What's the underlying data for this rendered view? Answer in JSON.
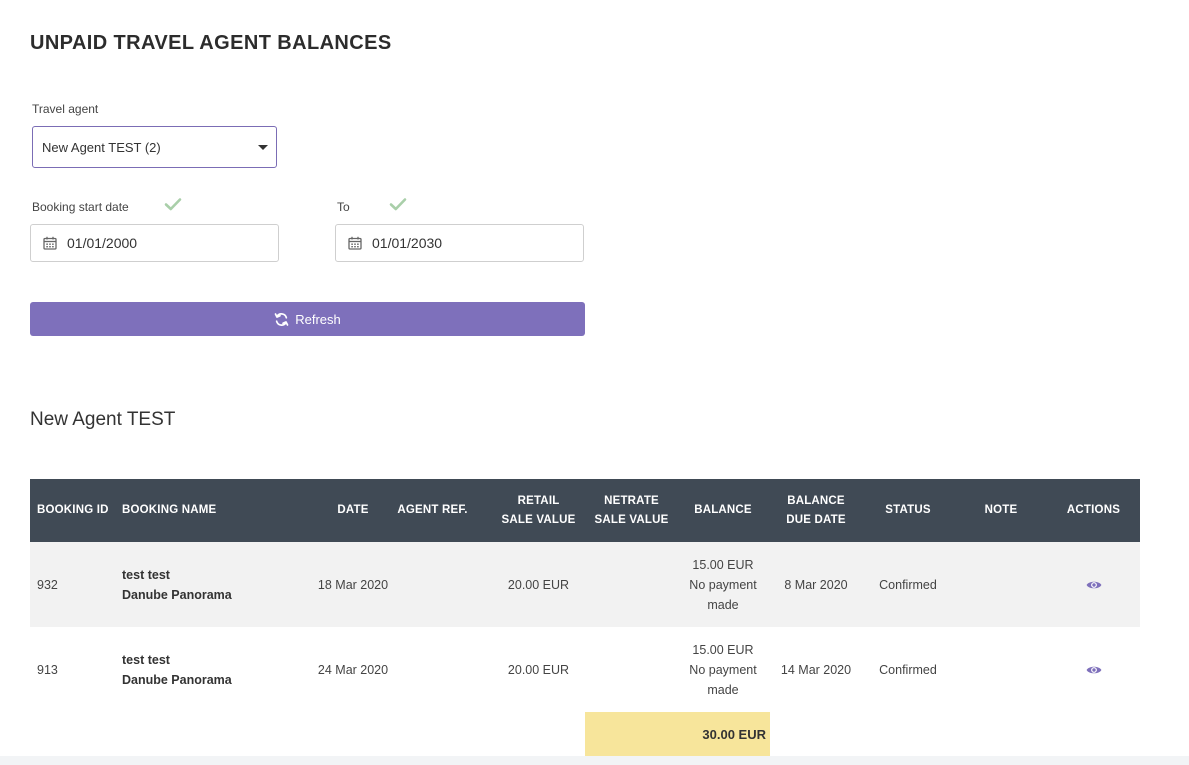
{
  "page": {
    "title": "UNPAID TRAVEL AGENT BALANCES"
  },
  "filters": {
    "travel_agent_label": "Travel agent",
    "travel_agent_value": "New Agent TEST (2)",
    "start_date_label": "Booking start date",
    "start_date_value": "01/01/2000",
    "end_date_label": "To",
    "end_date_value": "01/01/2030",
    "refresh_label": "Refresh"
  },
  "agent_section": {
    "heading": "New Agent TEST"
  },
  "table": {
    "headers": {
      "booking_id": "BOOKING ID",
      "booking_name": "BOOKING NAME",
      "date": "DATE",
      "agent_ref": "AGENT REF.",
      "retail_1": "RETAIL",
      "retail_2": "SALE VALUE",
      "netrate_1": "NETRATE",
      "netrate_2": "SALE VALUE",
      "balance": "BALANCE",
      "due_1": "BALANCE",
      "due_2": "DUE DATE",
      "status": "STATUS",
      "note": "NOTE",
      "actions": "ACTIONS"
    },
    "rows": [
      {
        "booking_id": "932",
        "name_line1": "test test",
        "name_line2": "Danube Panorama",
        "date": "18 Mar 2020",
        "agent_ref": "",
        "retail": "20.00 EUR",
        "netrate": "",
        "balance_amount": "15.00 EUR",
        "balance_note_1": "No payment",
        "balance_note_2": "made",
        "due_date": "8 Mar 2020",
        "status": "Confirmed",
        "note": ""
      },
      {
        "booking_id": "913",
        "name_line1": "test test",
        "name_line2": "Danube Panorama",
        "date": "24 Mar 2020",
        "agent_ref": "",
        "retail": "20.00 EUR",
        "netrate": "",
        "balance_amount": "15.00 EUR",
        "balance_note_1": "No payment",
        "balance_note_2": "made",
        "due_date": "14 Mar 2020",
        "status": "Confirmed",
        "note": ""
      }
    ],
    "total_balance": "30.00 EUR"
  },
  "colors": {
    "accent": "#7e70bb",
    "header_bg": "#404a55",
    "total_bg": "#f7e59b",
    "check": "#a9cfa9"
  },
  "icons": {
    "start_date_check": "check-icon",
    "end_date_check": "check-icon",
    "calendar": "calendar-icon",
    "refresh": "refresh-icon",
    "view": "eye-icon",
    "dropdown": "caret-down-icon"
  }
}
